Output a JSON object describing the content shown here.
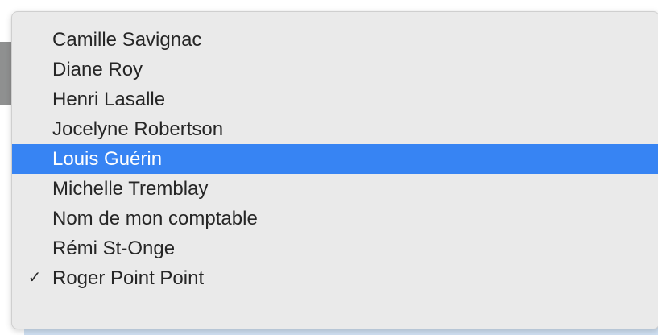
{
  "dropdown": {
    "items": [
      {
        "label": "Camille Savignac"
      },
      {
        "label": "Diane Roy"
      },
      {
        "label": "Henri Lasalle"
      },
      {
        "label": "Jocelyne Robertson"
      },
      {
        "label": "Louis Guérin"
      },
      {
        "label": "Michelle Tremblay"
      },
      {
        "label": "Nom de mon comptable"
      },
      {
        "label": "Rémi St-Onge"
      },
      {
        "label": "Roger Point Point"
      }
    ],
    "highlighted_index": 4,
    "checked_index": 8,
    "check_glyph": "✓",
    "highlight_color": "#3784f3"
  }
}
